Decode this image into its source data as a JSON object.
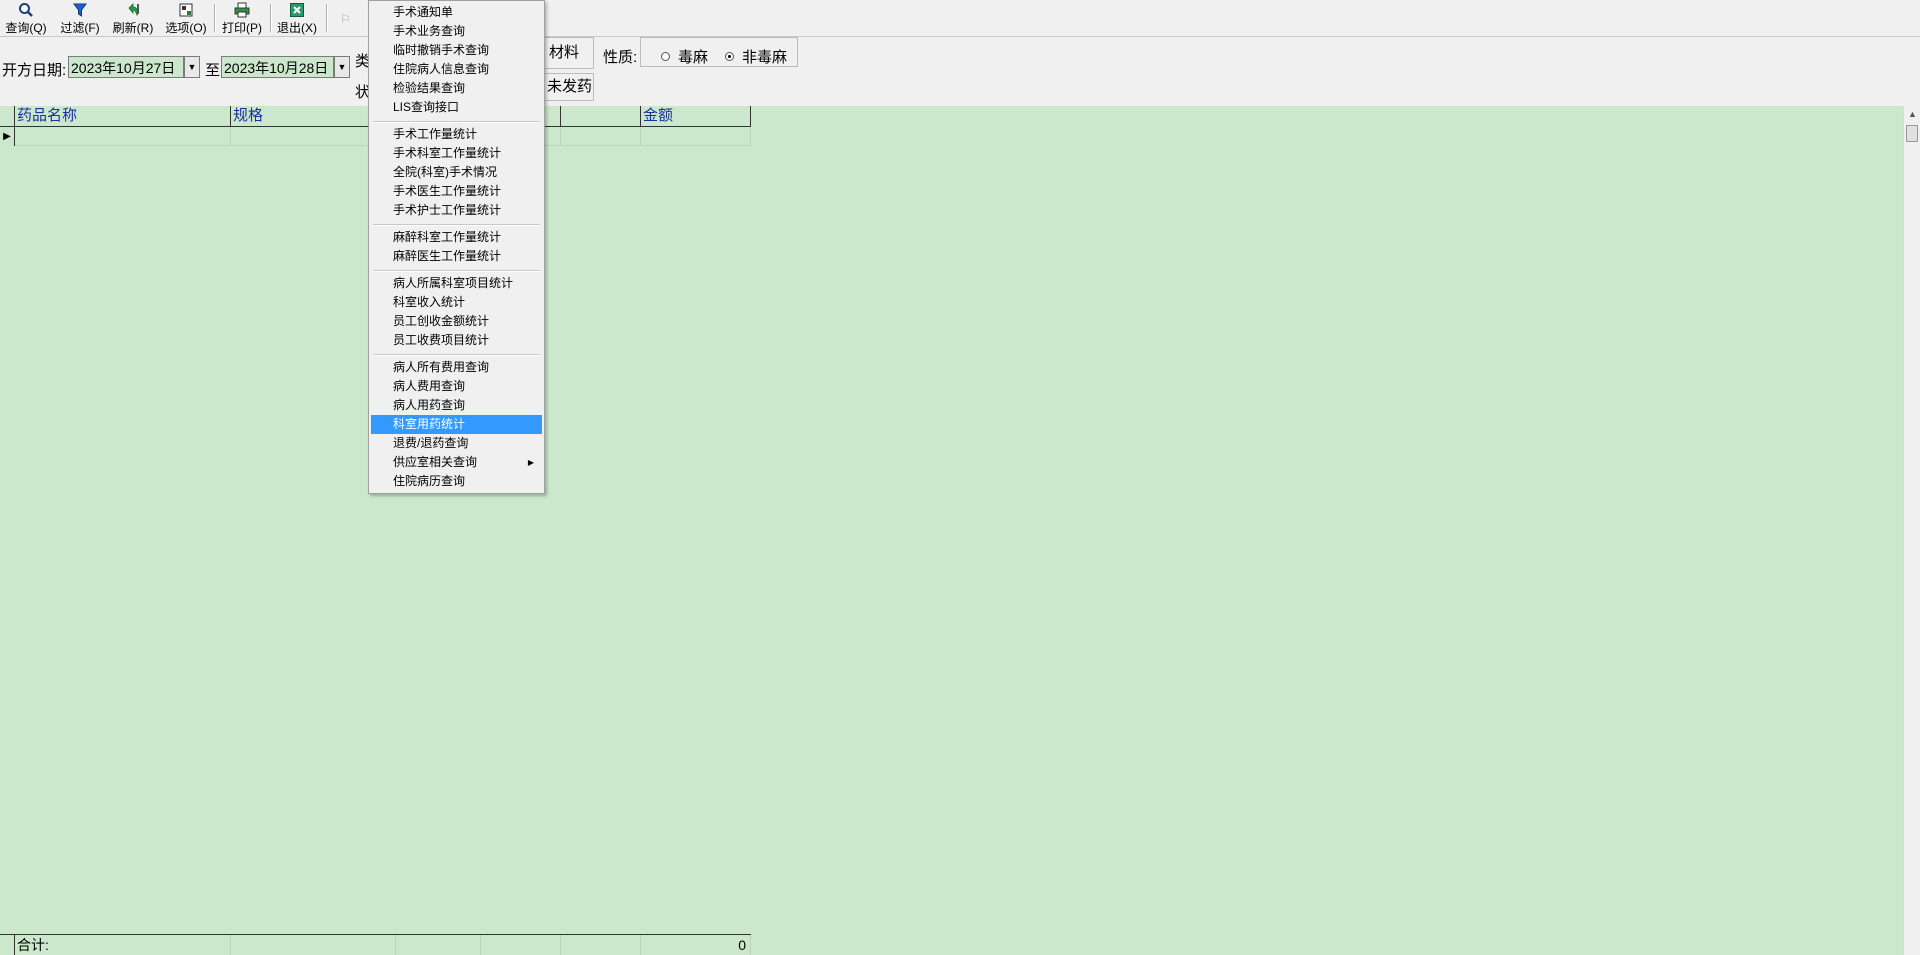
{
  "toolbar": {
    "buttons": [
      {
        "label": "查询(Q)",
        "icon": "magnifier-icon"
      },
      {
        "label": "过滤(F)",
        "icon": "filter-icon"
      },
      {
        "label": "刷新(R)",
        "icon": "refresh-icon"
      },
      {
        "label": "选项(O)",
        "icon": "options-icon"
      },
      {
        "label": "打印(P)",
        "icon": "printer-icon"
      },
      {
        "label": "退出(X)",
        "icon": "exit-icon"
      }
    ]
  },
  "filter": {
    "date_label": "开方日期:",
    "date_from": "2023年10月27日",
    "to_label": "至",
    "date_to": "2023年10月28日",
    "category_label_cut": "类",
    "status_label_cut": "状",
    "material": "材料",
    "nature_label": "性质:",
    "nature_options": [
      {
        "label": "毒麻",
        "checked": false
      },
      {
        "label": "非毒麻",
        "checked": true
      }
    ],
    "status_value": "未发药"
  },
  "grid": {
    "columns": [
      "药品名称",
      "规格",
      "",
      "",
      "",
      "金额"
    ],
    "footer_label": "合计:",
    "footer_total": "0"
  },
  "menu": {
    "groups": [
      [
        "手术通知单",
        "手术业务查询",
        "临时撤销手术查询",
        "住院病人信息查询",
        "检验结果查询",
        "LIS查询接口"
      ],
      [
        "手术工作量统计",
        "手术科室工作量统计",
        "全院(科室)手术情况",
        "手术医生工作量统计",
        "手术护士工作量统计"
      ],
      [
        "麻醉科室工作量统计",
        "麻醉医生工作量统计"
      ],
      [
        "病人所属科室项目统计",
        "科室收入统计",
        "员工创收金额统计",
        "员工收费项目统计"
      ],
      [
        "病人所有费用查询",
        "病人费用查询",
        "病人用药查询",
        "科室用药统计",
        "退费/退药查询",
        "供应室相关查询",
        "住院病历查询"
      ]
    ],
    "selected": "科室用药统计",
    "has_submenu": "供应室相关查询"
  }
}
